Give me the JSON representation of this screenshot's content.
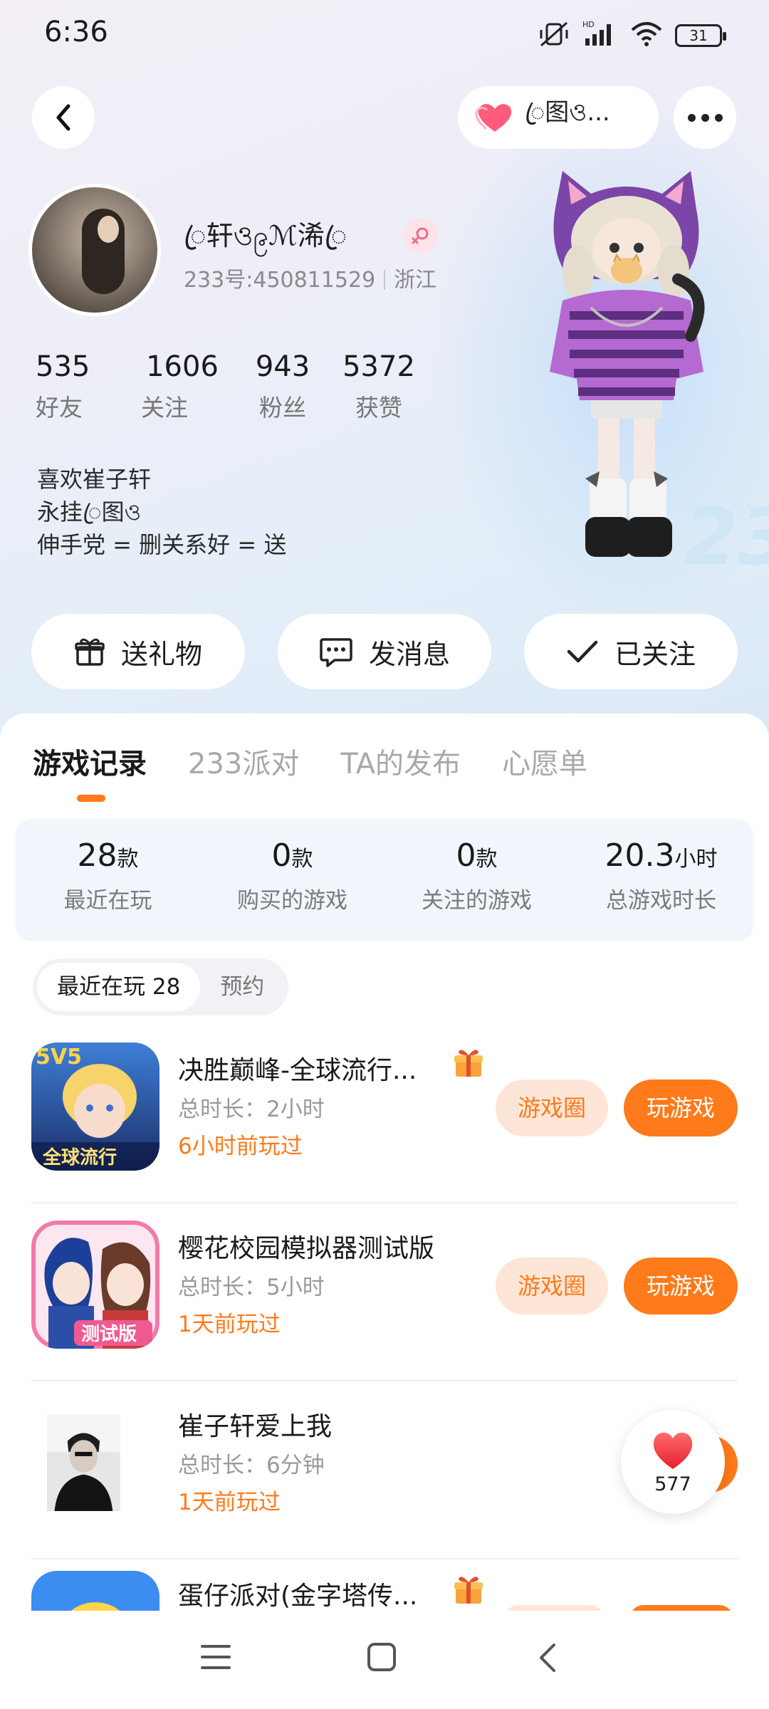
{
  "status_bar": {
    "time": "6:36",
    "battery": "31",
    "icons": [
      "mute-vibrate-icon",
      "hd-signal-icon",
      "wifi-icon",
      "battery-icon"
    ]
  },
  "header": {
    "family_pill_text": "ꦿ图ও...",
    "back_icon": "chevron-left-icon",
    "more_icon": "more-dots-icon"
  },
  "profile": {
    "nickname": "ꦿ轩ও၉ℳ浠ꦿ",
    "gender": "female",
    "id_label": "233号:450811529",
    "location": "浙江",
    "stats": [
      {
        "value": "535",
        "label": "好友"
      },
      {
        "value": "1606",
        "label": "关注"
      },
      {
        "value": "943",
        "label": "粉丝"
      },
      {
        "value": "5372",
        "label": "获赞"
      }
    ],
    "bio": [
      "喜欢崔子轩",
      "永挂ꦿ图ও",
      "伸手党 = 删关系好 = 送"
    ]
  },
  "actions": {
    "gift": "送礼物",
    "message": "发消息",
    "follow": "已关注"
  },
  "tabs": [
    "游戏记录",
    "233派对",
    "TA的发布",
    "心愿单"
  ],
  "active_tab": 0,
  "summary": [
    {
      "value": "28",
      "unit": "款",
      "label": "最近在玩"
    },
    {
      "value": "0",
      "unit": "款",
      "label": "购买的游戏"
    },
    {
      "value": "0",
      "unit": "款",
      "label": "关注的游戏"
    },
    {
      "value": "20.3",
      "unit": "小时",
      "label": "总游戏时长"
    }
  ],
  "segment": {
    "recent": "最近在玩 28",
    "reserve": "预约"
  },
  "games": [
    {
      "title": "决胜巅峰-全球流行...",
      "duration": "总时长：2小时",
      "last_played": "6小时前玩过",
      "circle_btn": "游戏圈",
      "play_btn": "玩游戏",
      "has_gift": true
    },
    {
      "title": "樱花校园模拟器测试版",
      "duration": "总时长：5小时",
      "last_played": "1天前玩过",
      "circle_btn": "游戏圈",
      "play_btn": "玩游戏",
      "has_gift": false
    },
    {
      "title": "崔子轩爱上我",
      "duration": "总时长：6分钟",
      "last_played": "1天前玩过",
      "circle_btn": "",
      "play_btn": "",
      "has_gift": false
    },
    {
      "title": "蛋仔派对(金字塔传...",
      "duration": "",
      "last_played": "",
      "circle_btn": "",
      "play_btn": "",
      "has_gift": true
    }
  ],
  "floating_like": {
    "count": "577"
  },
  "colors": {
    "accent": "#ff7a1a",
    "accent_light": "#fde6d7",
    "summary_bg": "#f1f6fd"
  }
}
